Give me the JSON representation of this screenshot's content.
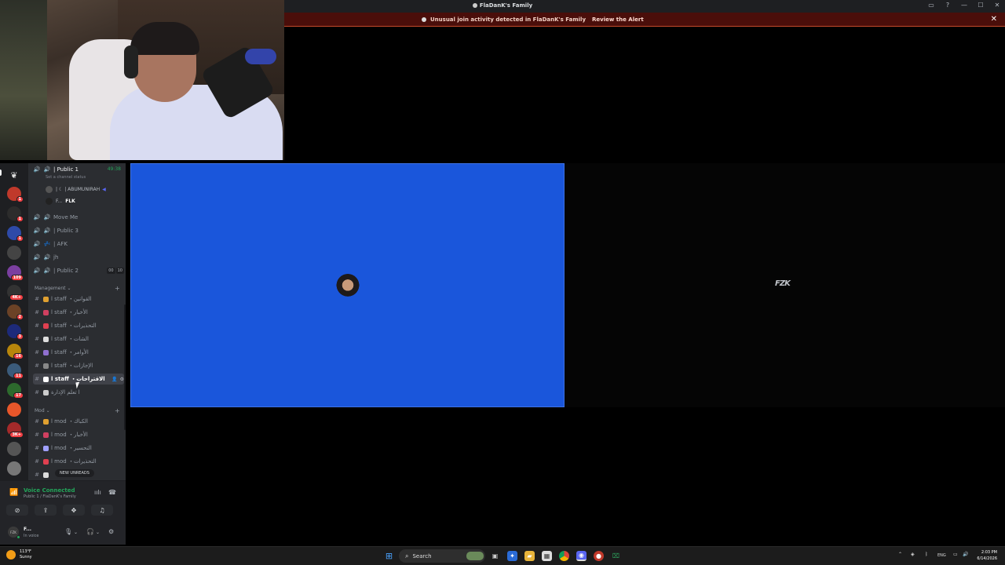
{
  "window": {
    "title": "FlaDanK's Family",
    "controls": [
      "inbox-icon",
      "help-icon",
      "minimize-icon",
      "maximize-icon",
      "close-icon"
    ]
  },
  "alert": {
    "message": "Unusual join activity detected in FlaDanK's Family",
    "action": "Review the Alert",
    "close": "✕"
  },
  "servers": [
    {
      "badge": "1",
      "color": "#c0392b"
    },
    {
      "badge": "1",
      "color": "#2c2c2c"
    },
    {
      "badge": "1",
      "color": "#2e4aa8"
    },
    {
      "badge": "",
      "color": "#444"
    },
    {
      "badge": "109",
      "color": "#7b3fa0"
    },
    {
      "badge": "4K+",
      "color": "#333"
    },
    {
      "badge": "2",
      "color": "#6b4226"
    },
    {
      "badge": "3",
      "color": "#1d2a7a"
    },
    {
      "badge": "16",
      "color": "#b8860b"
    },
    {
      "badge": "11",
      "color": "#3b5b7b"
    },
    {
      "badge": "17",
      "color": "#2d6a2d"
    },
    {
      "badge": "",
      "color": "#e8562a"
    },
    {
      "badge": "3K+",
      "color": "#a52a2a"
    },
    {
      "badge": "",
      "color": "#555"
    },
    {
      "badge": "",
      "color": "#777"
    }
  ],
  "voice_channels": {
    "current": {
      "name": "| Public 1",
      "timer": "49:38",
      "status": "Set a channel status"
    },
    "members": [
      {
        "name": "| ☾ | ABUMUNIRAH"
      },
      {
        "name": "F...",
        "tag": "FLK"
      }
    ],
    "others": [
      {
        "icon": "🔊",
        "name": "Move Me"
      },
      {
        "icon": "🔊",
        "name": "| Public 3"
      },
      {
        "icon": "💤",
        "name": "| AFK"
      },
      {
        "icon": "🔊",
        "name": "jh"
      },
      {
        "icon": "🔊",
        "name": "| Public 2",
        "counts": [
          "00",
          "10"
        ]
      }
    ]
  },
  "categories": {
    "management": "Management",
    "mod": "Mod"
  },
  "management_channels": [
    {
      "name": "ا staff ・القوانين",
      "color": "#e0a030"
    },
    {
      "name": "ا staff ・الأخبار",
      "color": "#d04060"
    },
    {
      "name": "ا staff ・التحذيرات",
      "color": "#e04050"
    },
    {
      "name": "ا staff ・الشات",
      "color": "#dddddd"
    },
    {
      "name": "ا staff ・الأوامر",
      "color": "#9070d0"
    },
    {
      "name": "ا staff ・الإجازات",
      "color": "#888888"
    },
    {
      "name": "ا staff ・الاقتراحات",
      "color": "#ffffff",
      "active": true
    },
    {
      "name": "ا تعلم الإدارة",
      "color": "#cccccc"
    }
  ],
  "mod_channels": [
    {
      "name": "ا mod ・الكباك",
      "color": "#e0a030"
    },
    {
      "name": "ا mod ・الأخبار",
      "color": "#d04060"
    },
    {
      "name": "ا mod ・التحسير",
      "color": "#a0a0ff"
    },
    {
      "name": "ا mod ・التحذيرات",
      "color": "#e04050"
    },
    {
      "name": "",
      "color": "#dddddd"
    }
  ],
  "new_unreads": "NEW UNREADS",
  "voice_panel": {
    "status": "Voice Connected",
    "location": "Public 1 / FlaDanK's Family"
  },
  "user": {
    "name": "F...",
    "status": "In voice",
    "avatar_text": "FZK"
  },
  "stage": {
    "left_bg": "#1a56db",
    "right_logo": "FZK"
  },
  "taskbar": {
    "temp": "113°F",
    "condition": "Sunny",
    "search": "Search",
    "lang": "ENG",
    "time": "2:03 PM",
    "date": "6/14/2026"
  }
}
